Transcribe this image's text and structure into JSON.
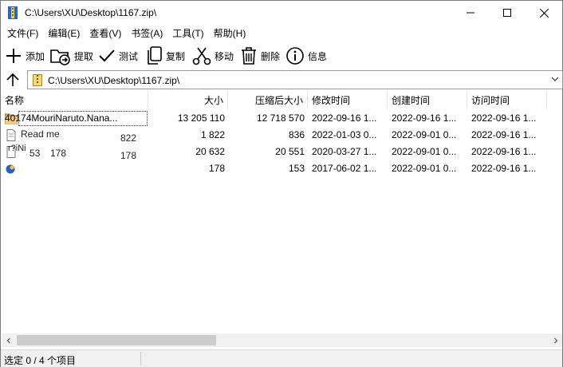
{
  "window": {
    "title": "C:\\Users\\XU\\Desktop\\1167.zip\\"
  },
  "menu": [
    "文件(F)",
    "编辑(E)",
    "查看(V)",
    "书签(A)",
    "工具(T)",
    "帮助(H)"
  ],
  "toolbar": {
    "add": "添加",
    "extract": "提取",
    "test": "测试",
    "copy": "复制",
    "move": "移动",
    "delete": "删除",
    "info": "信息"
  },
  "address": {
    "path": "C:\\Users\\XU\\Desktop\\1167.zip\\"
  },
  "columns": {
    "name": "名称",
    "size": "大小",
    "packed": "压缩后大小",
    "modified": "修改时间",
    "created": "创建时间",
    "accessed": "访问时间"
  },
  "rows": [
    {
      "name": "40174MouriNaruto.Nana...",
      "size": "13 205 110",
      "packed": "12 718 570",
      "modified": "2022-09-16 1...",
      "created": "2022-09-16 1...",
      "accessed": "2022-09-16 1...",
      "icon": "folder-icon"
    },
    {
      "name": "",
      "size": "1 822",
      "packed": "836",
      "modified": "2022-01-03 0...",
      "created": "2022-09-01 0...",
      "accessed": "2022-09-16 1...",
      "icon": "text-file-icon"
    },
    {
      "name": "",
      "size": "20 632",
      "packed": "20 551",
      "modified": "2020-03-27 1...",
      "created": "2022-09-01 0...",
      "accessed": "2022-09-16 1...",
      "icon": "file-icon"
    },
    {
      "name": "",
      "size": "178",
      "packed": "153",
      "modified": "2017-06-02 1...",
      "created": "2022-09-01 0...",
      "accessed": "2022-09-16 1...",
      "icon": "blue-app-icon"
    }
  ],
  "ghost": {
    "readme": "Read me",
    "val1": "822",
    "val2": "53",
    "val3": "178",
    "val4": "178",
    "fragment": "r?iNi"
  },
  "status": {
    "text": "选定 0 / 4 个项目"
  }
}
